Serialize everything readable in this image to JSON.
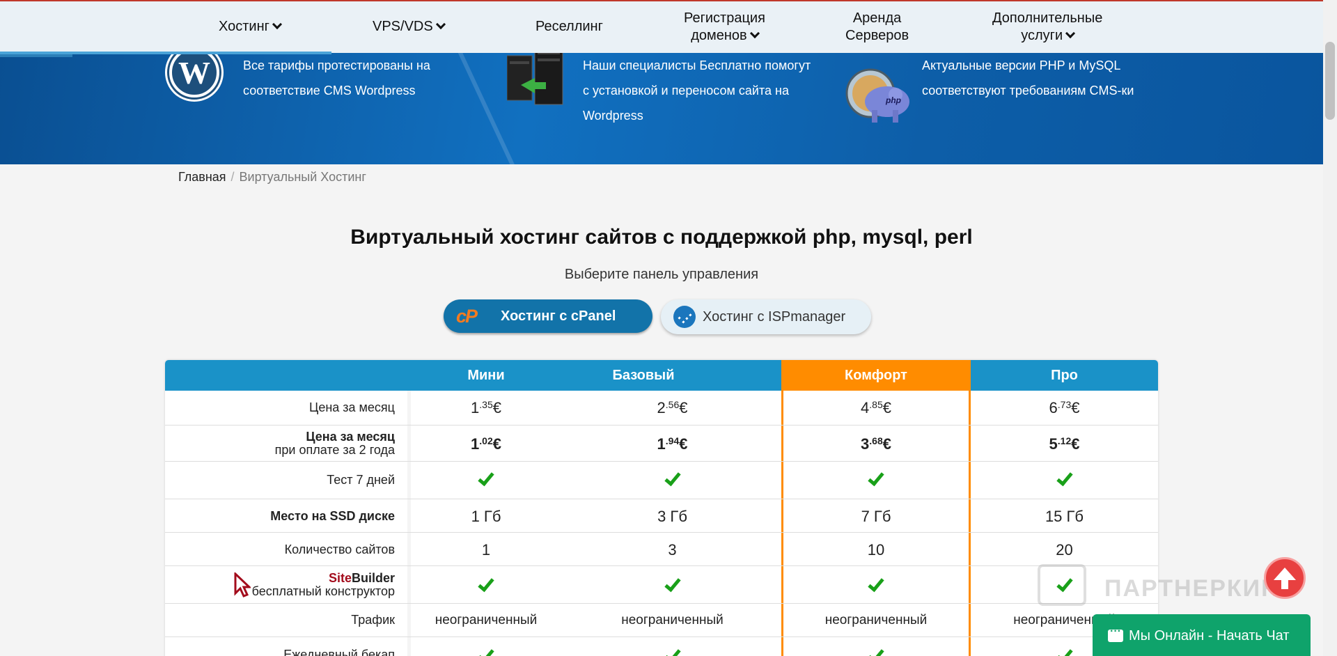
{
  "nav": {
    "items": [
      {
        "label": "Хостинг",
        "dropdown": true
      },
      {
        "label": "VPS/VDS",
        "dropdown": true
      },
      {
        "label": "Реселлинг",
        "dropdown": false
      },
      {
        "label": "Регистрация",
        "label2": "доменов",
        "dropdown": true
      },
      {
        "label": "Аренда",
        "label2": "Серверов",
        "dropdown": false
      },
      {
        "label": "Дополнительные",
        "label2": "услуги",
        "dropdown": true
      }
    ]
  },
  "banner": {
    "wp_text_1": "Все тарифы протестированы на",
    "wp_text_2": "соответствие CMS Wordpress",
    "support_text_1": "Наши специалисты Бесплатно помогут",
    "support_text_2": "с установкой и переносом сайта на",
    "support_text_3": "Wordpress",
    "php_text_1": "Актуальные версии PHP и MySQL",
    "php_text_2": "соответствуют требованиям CMS-ки"
  },
  "breadcrumb": {
    "home": "Главная",
    "sep": "/",
    "current": "Виртуальный Хостинг"
  },
  "title": "Виртуальный хостинг сайтов с поддержкой php, mysql, perl",
  "subtitle": "Выберите панель управления",
  "buttons": {
    "cpanel_logo": "cP",
    "cpanel": "Хостинг с cPanel",
    "isp": "Хостинг с ISPmanager"
  },
  "table": {
    "plans": [
      "Мини",
      "Базовый",
      "Комфорт",
      "Про"
    ],
    "highlight_color": "#ff8c00",
    "header_color": "#1a92c8",
    "row_price_label": "Цена за месяц",
    "row_price2_label": "Цена за месяц",
    "row_price2_sub": "при оплате за 2 года",
    "row_test_label": "Тест 7 дней",
    "row_ssd_label": "Место на SSD диске",
    "row_sites_label": "Количество сайтов",
    "row_sb_label_a": "Site",
    "row_sb_label_b": "Builder",
    "row_sb_sub": "бесплатный конструктор",
    "row_traffic_label": "Трафик",
    "row_backup_label": "Ежедневный бекап",
    "price_int": [
      "1",
      "2",
      "4",
      "6"
    ],
    "price_frac": [
      ".35",
      ".56",
      ".85",
      ".73"
    ],
    "price2_int": [
      "1",
      "1",
      "3",
      "5"
    ],
    "price2_frac": [
      ".02",
      ".94",
      ".68",
      ".12"
    ],
    "currency": "€",
    "ssd": [
      "1 Гб",
      "3 Гб",
      "7 Гб",
      "15 Гб"
    ],
    "sites": [
      "1",
      "3",
      "10",
      "20"
    ],
    "traffic": [
      "неограниченный",
      "неограниченный",
      "неограниченный",
      "неограниченный"
    ]
  },
  "watermark": "ПАРТНЕРКИН",
  "chat": "Мы Онлайн - Начать Чат"
}
